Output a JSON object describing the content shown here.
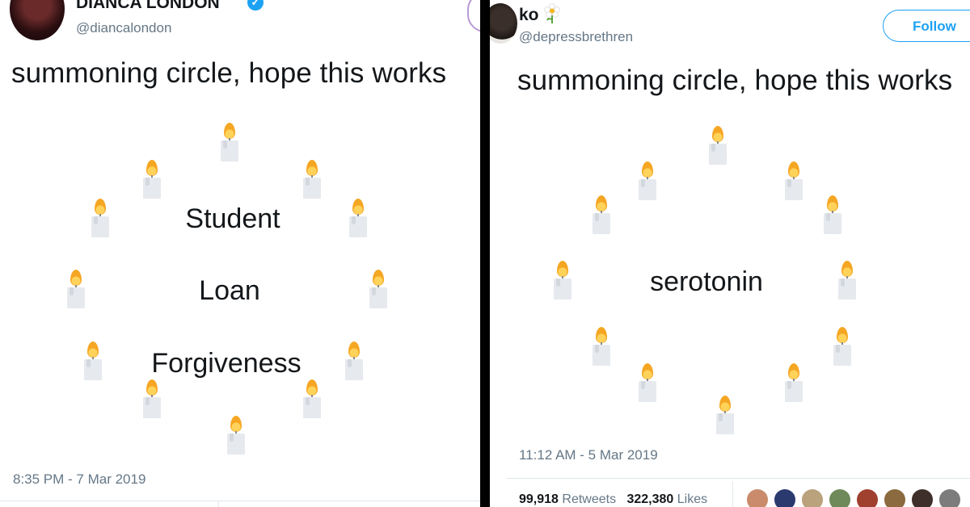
{
  "left_tweet": {
    "display_name": "DIANCA LONDON",
    "handle": "@diancalondon",
    "text": "summoning circle, hope this works",
    "circle_words": [
      "Student",
      "Loan",
      "Forgiveness"
    ],
    "timestamp": "8:35 PM - 7 Mar 2019",
    "verified": true
  },
  "right_tweet": {
    "display_name": "ko",
    "handle": "@depressbrethren",
    "text": "summoning circle, hope this works",
    "circle_words": [
      "serotonin"
    ],
    "timestamp": "11:12 AM - 5 Mar 2019",
    "follow_label": "Follow",
    "retweets_count": "99,918",
    "retweets_label": "Retweets",
    "likes_count": "322,380",
    "likes_label": "Likes"
  },
  "colors": {
    "twitter_blue": "#1da1f2",
    "secondary_text": "#657786",
    "divider": "#000000"
  },
  "icons": [
    "verified-badge-icon",
    "daisy-flower-icon",
    "candle-icon"
  ]
}
